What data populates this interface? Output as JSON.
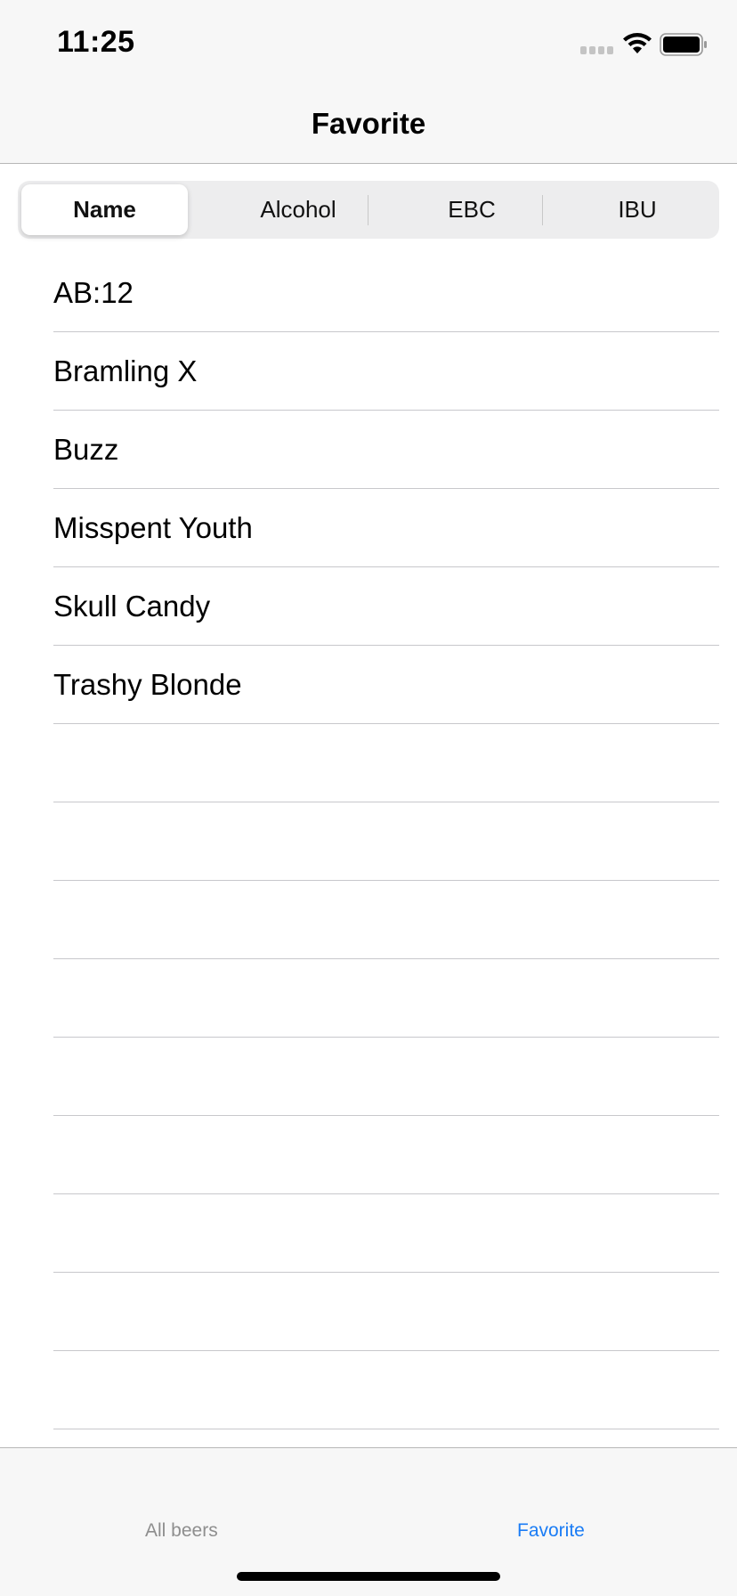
{
  "status_bar": {
    "time": "11:25"
  },
  "nav": {
    "title": "Favorite"
  },
  "segments": {
    "name": "Name",
    "alcohol": "Alcohol",
    "ebc": "EBC",
    "ibu": "IBU",
    "selected": "Name"
  },
  "beers": [
    "AB:12",
    "Bramling X",
    "Buzz",
    "Misspent Youth",
    "Skull Candy",
    "Trashy Blonde"
  ],
  "tab_bar": {
    "all_beers": "All beers",
    "favorite": "Favorite",
    "selected": "Favorite"
  },
  "colors": {
    "accent": "#1a7cf5",
    "inactive": "#8e8e8e"
  }
}
